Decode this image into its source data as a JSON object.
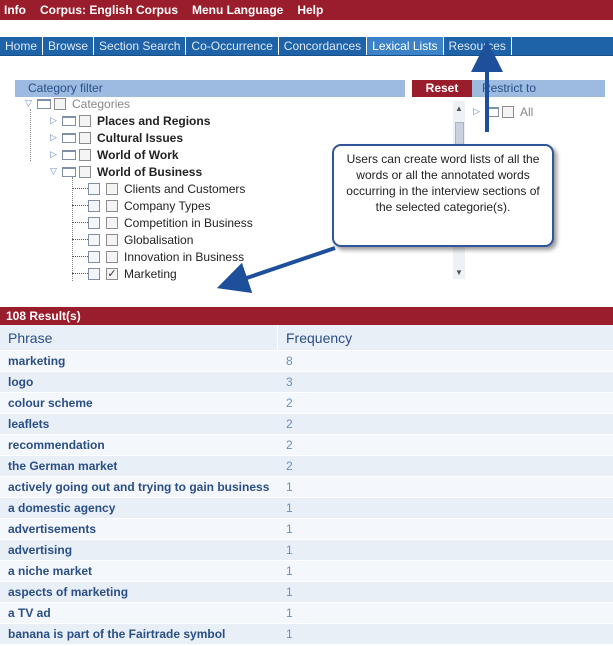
{
  "top_menu": [
    "Info",
    "Corpus: English Corpus",
    "Menu Language",
    "Help"
  ],
  "tabs": [
    {
      "label": "Home",
      "active": false
    },
    {
      "label": "Browse",
      "active": false
    },
    {
      "label": "Section Search",
      "active": false
    },
    {
      "label": "Co-Occurrence",
      "active": false
    },
    {
      "label": "Concordances",
      "active": false
    },
    {
      "label": "Lexical Lists",
      "active": true
    },
    {
      "label": "Resources",
      "active": false
    }
  ],
  "category_filter": {
    "title": "Category filter",
    "reset_label": "Reset",
    "restrict_title": "Restrict to",
    "restrict_all_label": "All",
    "root": "Categories",
    "top_categories": [
      "Places and Regions",
      "Cultural Issues",
      "World of Work",
      "World of Business"
    ],
    "subcategories": [
      {
        "label": "Clients and Customers",
        "checked": false
      },
      {
        "label": "Company Types",
        "checked": false
      },
      {
        "label": "Competition in Business",
        "checked": false
      },
      {
        "label": "Globalisation",
        "checked": false
      },
      {
        "label": "Innovation in Business",
        "checked": false
      },
      {
        "label": "Marketing",
        "checked": true
      }
    ]
  },
  "callout": {
    "text": "Users can create word lists of all the words or all the annotated words occurring in the interview sections of the selected categorie(s)."
  },
  "results": {
    "count_label": "108 Result(s)",
    "columns": [
      "Phrase",
      "Frequency"
    ],
    "rows": [
      {
        "phrase": "marketing",
        "frequency": "8"
      },
      {
        "phrase": "logo",
        "frequency": "3"
      },
      {
        "phrase": "colour scheme",
        "frequency": "2"
      },
      {
        "phrase": "leaflets",
        "frequency": "2"
      },
      {
        "phrase": "recommendation",
        "frequency": "2"
      },
      {
        "phrase": "the German market",
        "frequency": "2"
      },
      {
        "phrase": "actively going out and trying to gain business",
        "frequency": "1"
      },
      {
        "phrase": "a domestic agency",
        "frequency": "1"
      },
      {
        "phrase": "advertisements",
        "frequency": "1"
      },
      {
        "phrase": "advertising",
        "frequency": "1"
      },
      {
        "phrase": "a niche market",
        "frequency": "1"
      },
      {
        "phrase": "aspects of marketing",
        "frequency": "1"
      },
      {
        "phrase": "a TV ad",
        "frequency": "1"
      },
      {
        "phrase": "banana is part of the Fairtrade symbol",
        "frequency": "1"
      }
    ]
  },
  "colors": {
    "brand_red": "#9a1d2b",
    "tab_blue": "#1e62a8",
    "header_light_blue": "#9dbbe0",
    "link_blue": "#2a4e86",
    "arrow_blue": "#1e4f9a"
  }
}
